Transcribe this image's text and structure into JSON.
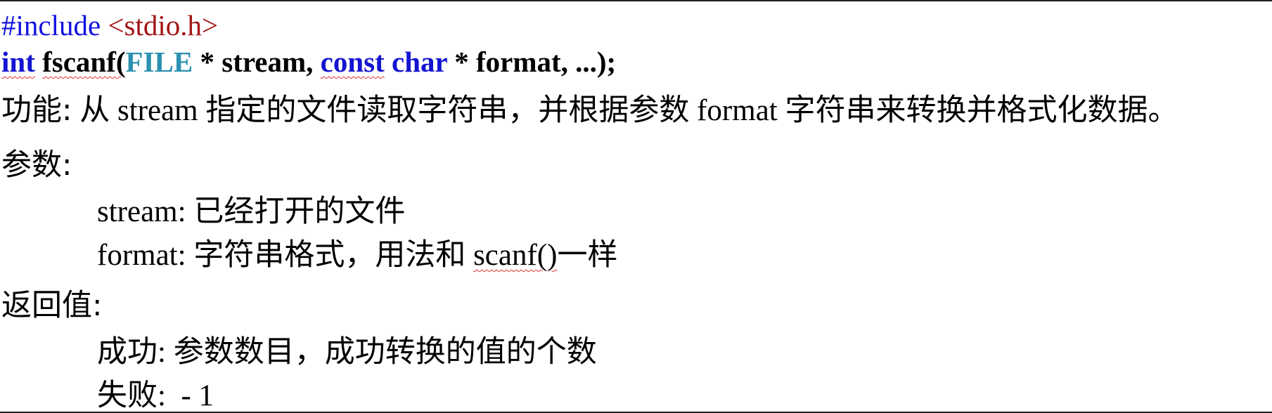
{
  "include_line": {
    "directive": "#include",
    "header": " <stdio.h>"
  },
  "signature": {
    "return_type": "int",
    "function_name": "fscanf(",
    "param1_type": "FILE",
    "param1_rest": " * stream, ",
    "param2_const": "const",
    "param2_char": " char",
    "param2_rest": " * format, ...);"
  },
  "description": {
    "label": "功能:",
    "text": " 从 stream 指定的文件读取字符串，并根据参数 format 字符串来转换并格式化数据。"
  },
  "params": {
    "label": "参数:",
    "stream": {
      "name": "stream:",
      "desc": " 已经打开的文件"
    },
    "format": {
      "name": "format:",
      "desc": " 字符串格式，用法和 ",
      "ref": "scanf()",
      "suffix": "一样"
    }
  },
  "return_value": {
    "label": "返回值:",
    "success": {
      "label": "成功:",
      "desc": " 参数数目，成功转换的值的个数"
    },
    "failure": {
      "label": "失败:",
      "desc": "  - 1"
    }
  },
  "colors": {
    "directive": "#1010e0",
    "header": "#a31515",
    "keyword": "#1414d2",
    "type": "#2b91af",
    "spellcheck_underline": "#e03030"
  }
}
